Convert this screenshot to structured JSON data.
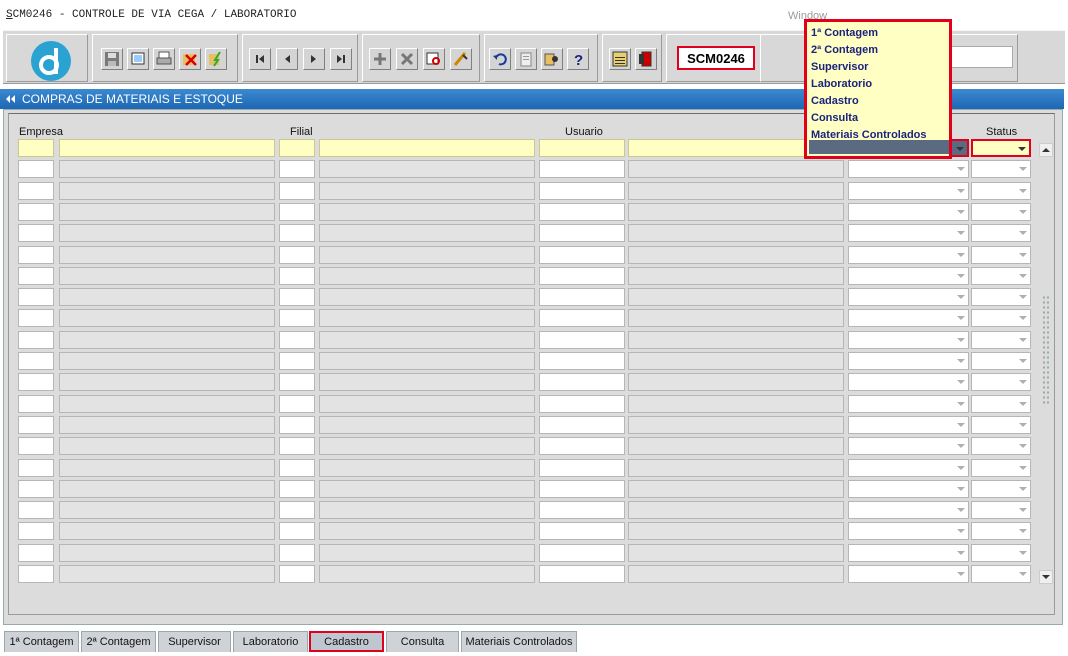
{
  "window": {
    "title_underlined": "S",
    "title_rest": "CM0246 - CONTROLE DE VIA CEGA / LABORATORIO",
    "menu_window": "Window"
  },
  "toolbar": {
    "form_code": "SCM0246",
    "buttons": [
      "save-icon",
      "print-preview-icon",
      "print-icon",
      "delete-record-icon",
      "flash-icon",
      "first-record-icon",
      "previous-record-icon",
      "next-record-icon",
      "last-record-icon",
      "insert-record-icon",
      "remove-record-icon",
      "query-icon",
      "clear-icon",
      "undo-icon",
      "clipboard-icon",
      "tools-icon",
      "help-icon",
      "menu-icon",
      "exit-icon"
    ]
  },
  "panel": {
    "title": "COMPRAS DE MATERIAIS E ESTOQUE"
  },
  "grid": {
    "headers": {
      "empresa": "Empresa",
      "filial": "Filial",
      "usuario": "Usuario",
      "status": "Status"
    },
    "row_count": 21
  },
  "dropdown": {
    "options": [
      "1ª Contagem",
      "2ª Contagem",
      "Supervisor",
      "Laboratorio",
      "Cadastro",
      "Consulta",
      "Materiais Controlados"
    ]
  },
  "tabs": [
    {
      "label": "1ª Contagem",
      "active": false
    },
    {
      "label": "2ª Contagem",
      "active": false
    },
    {
      "label": "Supervisor",
      "active": false
    },
    {
      "label": "Laboratorio",
      "active": false
    },
    {
      "label": "Cadastro",
      "active": true
    },
    {
      "label": "Consulta",
      "active": false
    },
    {
      "label": "Materiais Controlados",
      "active": false
    }
  ],
  "colors": {
    "header_blue": "#1d67b4",
    "highlight_red": "#e0001b",
    "yellow_cell": "#ffffc4",
    "logo_blue": "#2aa3d3"
  }
}
